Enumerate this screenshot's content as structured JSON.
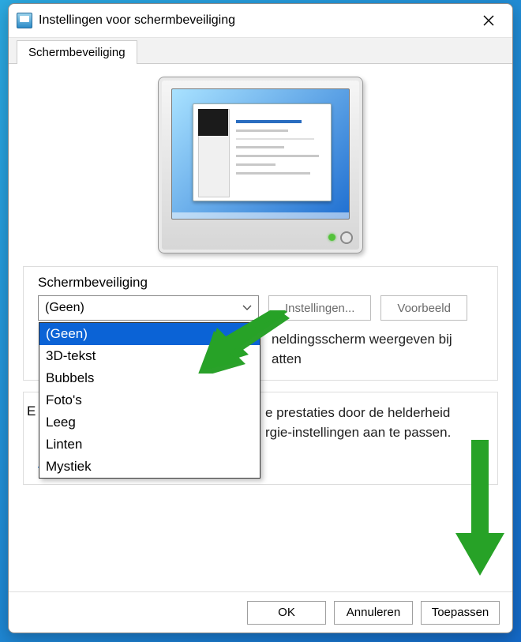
{
  "window": {
    "title": "Instellingen voor schermbeveiliging"
  },
  "tab": {
    "label": "Schermbeveiliging"
  },
  "screensaver": {
    "section_label": "Schermbeveiliging",
    "selected": "(Geen)",
    "options": [
      "(Geen)",
      "3D-tekst",
      "Bubbels",
      "Foto's",
      "Leeg",
      "Linten",
      "Mystiek"
    ],
    "settings_btn": "Instellingen...",
    "preview_btn": "Voorbeeld",
    "checkbox_text_visible_right": "neldingsscherm weergeven bij",
    "checkbox_text_visible_right2": "atten"
  },
  "power": {
    "leading_letter": "E",
    "line1_partial": "e prestaties door de helderheid",
    "line2_partial": "rgie-instellingen aan te passen.",
    "link": "Energie-instellingen wijzigen"
  },
  "footer": {
    "ok": "OK",
    "cancel": "Annuleren",
    "apply": "Toepassen"
  }
}
